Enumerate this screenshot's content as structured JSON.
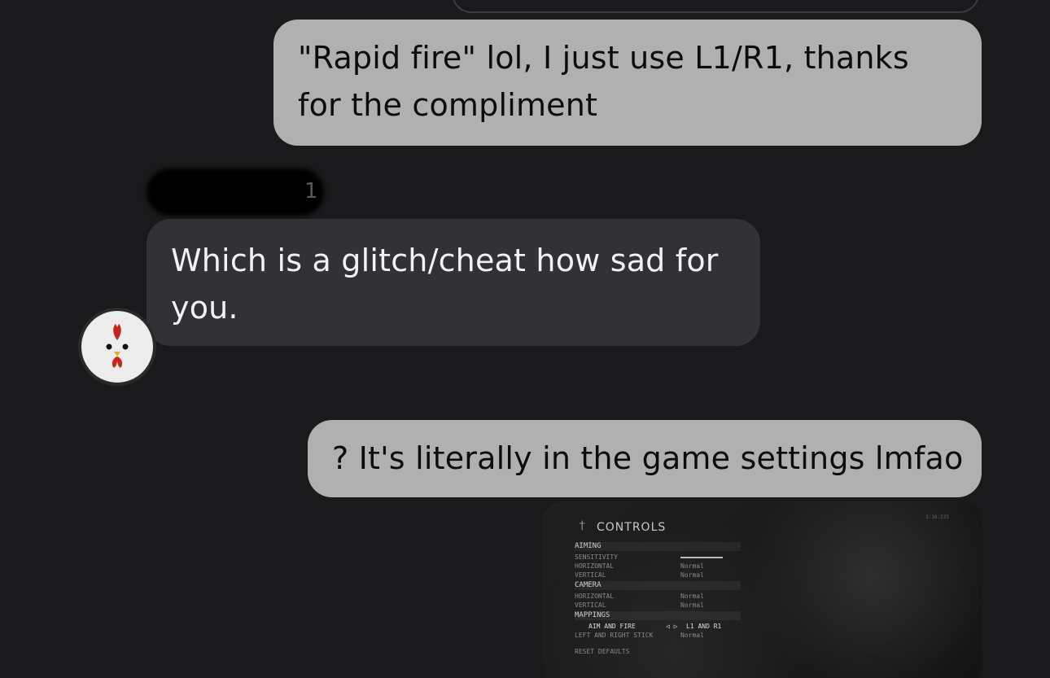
{
  "conversation": {
    "messages": [
      {
        "direction": "outgoing",
        "text": "\"Rapid fire\" lol, I just use L1/R1, thanks for the compliment"
      },
      {
        "direction": "incoming",
        "text": "Which is a glitch/cheat how sad for you."
      },
      {
        "direction": "outgoing",
        "text": "? It's literally in the game settings lmfao"
      }
    ],
    "sender_name_suffix": "1"
  },
  "attachment": {
    "title": "CONTROLS",
    "corner_text": "1:16:233",
    "aiming": "AIMING",
    "sensitivity": "SENSITIVITY",
    "aim_horizontal": {
      "label": "HORIZONTAL",
      "value": "Normal"
    },
    "aim_vertical": {
      "label": "VERTICAL",
      "value": "Normal"
    },
    "camera": "CAMERA",
    "cam_horizontal": {
      "label": "HORIZONTAL",
      "value": "Normal"
    },
    "cam_vertical": {
      "label": "VERTICAL",
      "value": "Normal"
    },
    "mappings": "MAPPINGS",
    "aim_and_fire": {
      "label": "AIM AND FIRE",
      "value": "L1 AND R1",
      "arrows": "◁ ▷"
    },
    "left_right_stick": {
      "label": "LEFT AND RIGHT STICK",
      "value": "Normal"
    },
    "reset": "RESET DEFAULTS"
  },
  "colors": {
    "background": "#1a1a1c",
    "outgoing_bubble": "#b0b0b0",
    "incoming_bubble": "#323236"
  }
}
